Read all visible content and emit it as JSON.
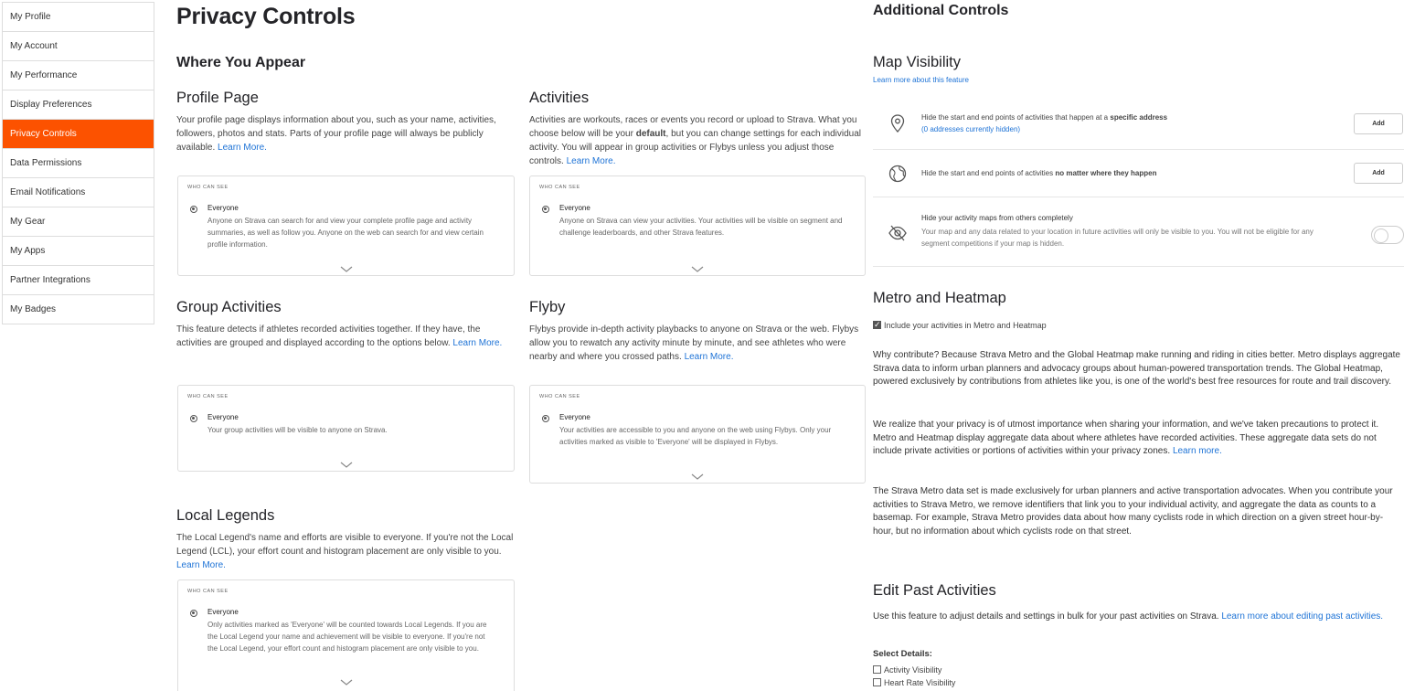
{
  "sidebar": {
    "items": [
      {
        "label": "My Profile"
      },
      {
        "label": "My Account"
      },
      {
        "label": "My Performance"
      },
      {
        "label": "Display Preferences"
      },
      {
        "label": "Privacy Controls"
      },
      {
        "label": "Data Permissions"
      },
      {
        "label": "Email Notifications"
      },
      {
        "label": "My Gear"
      },
      {
        "label": "My Apps"
      },
      {
        "label": "Partner Integrations"
      },
      {
        "label": "My Badges"
      }
    ],
    "active_color": "#fc5200"
  },
  "main": {
    "title": "Privacy Controls",
    "section_title": "Where You Appear",
    "who_can_see": "Who can see",
    "option_label": "Everyone",
    "learn_more": "Learn More.",
    "profile": {
      "title": "Profile Page",
      "desc": "Your profile page displays information about you, such as your name, activities, followers, photos and stats. Parts of your profile page will always be publicly available.",
      "option_desc": "Anyone on Strava can search for and view your complete profile page and activity summaries, as well as follow you. Anyone on the web can search for and view certain profile information."
    },
    "activities": {
      "title": "Activities",
      "desc_1": "Activities are workouts, races or events you record or upload to Strava. What you choose below will be your",
      "desc_bold": "default",
      "desc_2": ", but you can change settings for each individual activity. You will appear in group activities or Flybys unless you adjust those controls.",
      "option_desc": "Anyone on Strava can view your activities. Your activities will be visible on segment and challenge leaderboards, and other Strava features."
    },
    "group": {
      "title": "Group Activities",
      "desc": "This feature detects if athletes recorded activities together. If they have, the activities are grouped and displayed according to the options below.",
      "option_desc": "Your group activities will be visible to anyone on Strava."
    },
    "flyby": {
      "title": "Flyby",
      "desc": "Flybys provide in-depth activity playbacks to anyone on Strava or the web. Flybys allow you to rewatch any activity minute by minute, and see athletes who were nearby and where you crossed paths.",
      "option_desc": "Your activities are accessible to you and anyone on the web using Flybys. Only your activities marked as visible to 'Everyone' will be displayed in Flybys."
    },
    "legends": {
      "title": "Local Legends",
      "desc": "The Local Legend's name and efforts are visible to everyone. If you're not the Local Legend (LCL), your effort count and histogram placement are only visible to you.",
      "option_desc": "Only activities marked as 'Everyone' will be counted towards Local Legends. If you are the Local Legend your name and achievement will be visible to everyone. If you're not the Local Legend, your effort count and histogram placement are only visible to you."
    }
  },
  "right": {
    "title": "Additional Controls",
    "map": {
      "title": "Map Visibility",
      "learn": "Learn more about this feature",
      "row1_text": "Hide the start and end points of activities that happen at a",
      "row1_bold": "specific address",
      "row1_sub": "(0 addresses currently hidden)",
      "row2_text": "Hide the start and end points of activities",
      "row2_bold": "no matter where they happen",
      "add_label": "Add",
      "row3_title": "Hide your activity maps from others completely",
      "row3_desc": "Your map and any data related to your location in future activities will only be visible to you. You will not be eligible for any segment competitions if your map is hidden."
    },
    "metro": {
      "title": "Metro and Heatmap",
      "checkbox_label": "Include your activities in Metro and Heatmap",
      "p1": "Why contribute? Because Strava Metro and the Global Heatmap make running and riding in cities better. Metro displays aggregate Strava data to inform urban planners and advocacy groups about human-powered transportation trends. The Global Heatmap, powered exclusively by contributions from athletes like you, is one of the world's best free resources for route and trail discovery.",
      "p2": "We realize that your privacy is of utmost importance when sharing your information, and we've taken precautions to protect it. Metro and Heatmap display aggregate data about where athletes have recorded activities. These aggregate data sets do not include private activities or portions of activities within your privacy zones.",
      "p2_link": "Learn more.",
      "p3": "The Strava Metro data set is made exclusively for urban planners and active transportation advocates. When you contribute your activities to Strava Metro, we remove identifiers that link you to your individual activity, and aggregate the data as counts to a basemap. For example, Strava Metro provides data about how many cyclists rode in which direction on a given street hour-by-hour, but no information about which cyclists rode on that street."
    },
    "edit": {
      "title": "Edit Past Activities",
      "desc": "Use this feature to adjust details and settings in bulk for your past activities on Strava.",
      "link": "Learn more about editing past activities.",
      "select_label": "Select Details:",
      "options": [
        "Activity Visibility",
        "Heart Rate Visibility"
      ]
    }
  }
}
